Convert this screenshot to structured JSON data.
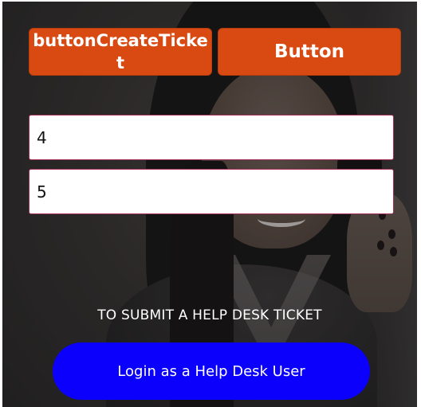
{
  "buttons": {
    "create_ticket_label": "buttonCreateTicket",
    "generic_label": "Button",
    "login_label": "Login as a Help Desk User"
  },
  "fields": {
    "first_value": "4",
    "second_value": "5"
  },
  "caption": "TO SUBMIT A HELP DESK TICKET",
  "colors": {
    "accent_orange": "#d84a12",
    "login_blue": "#0a00fb",
    "field_border": "#a3305a"
  }
}
